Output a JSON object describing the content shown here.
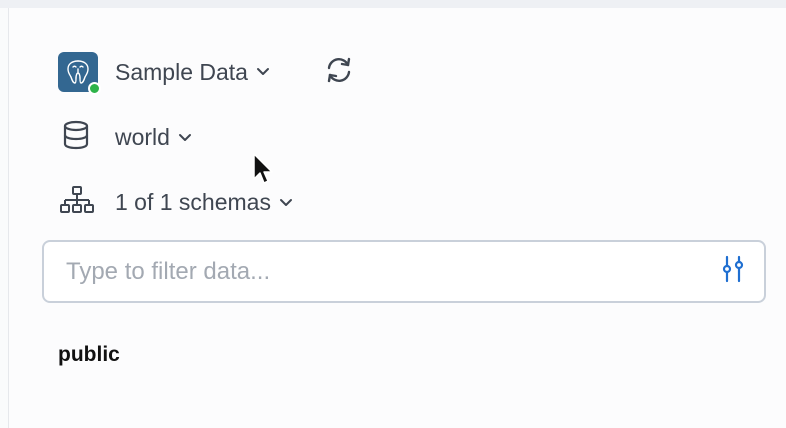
{
  "connection": {
    "name": "Sample Data",
    "logo_icon": "postgres-elephant-icon",
    "status": "connected",
    "status_color": "#2eb34a",
    "logo_color": "#336791"
  },
  "database": {
    "name": "world",
    "icon": "database-icon"
  },
  "schemas": {
    "label": "1 of 1 schemas",
    "icon": "schema-tree-icon"
  },
  "filter": {
    "placeholder": "Type to filter data...",
    "value": "",
    "icon": "sliders-icon",
    "icon_color": "#1f6fd1"
  },
  "schema_list": [
    {
      "name": "public"
    }
  ]
}
